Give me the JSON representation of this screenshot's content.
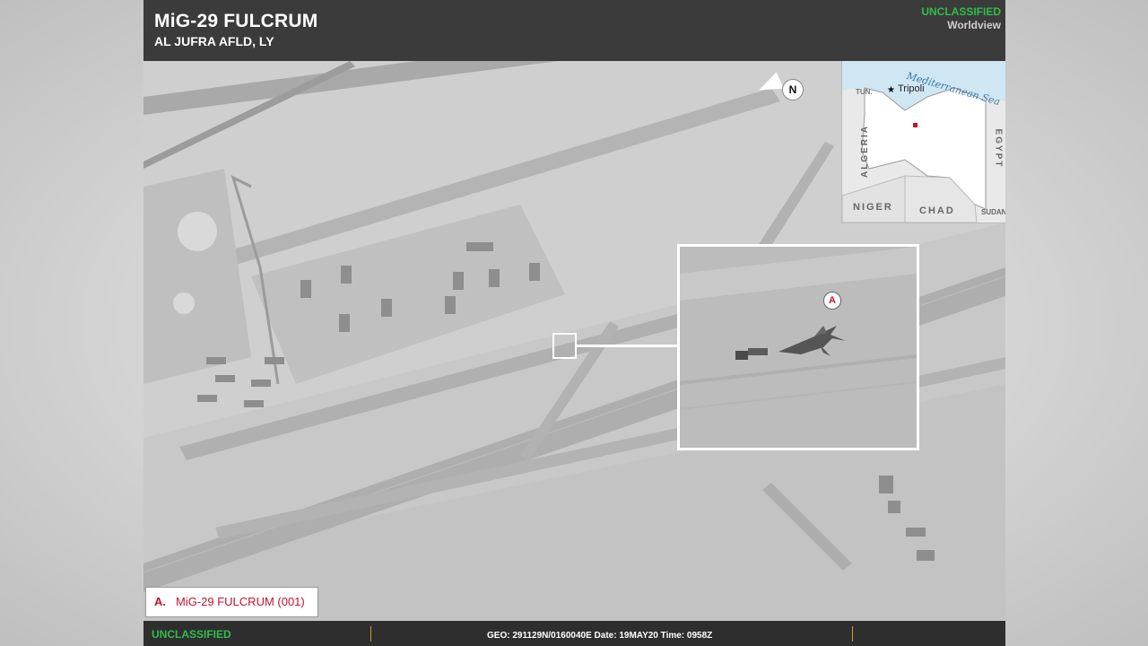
{
  "header": {
    "title": "MiG-29 FULCRUM",
    "subtitle": "AL JUFRA AFLD, LY",
    "classification": "UNCLASSIFIED",
    "source": "Worldview"
  },
  "locator_map": {
    "city": "Tripoli",
    "sea": "Mediterranean Sea",
    "countries": [
      "TUN.",
      "ALGERIA",
      "EGYPT",
      "NIGER",
      "CHAD",
      "SUDAN"
    ],
    "highlight_color": "#ffffff",
    "water_color": "#cfe6f3",
    "marker_color": "#c8102e"
  },
  "compass": {
    "label": "N"
  },
  "inset": {
    "marker_label": "A"
  },
  "legend": {
    "letter": "A.",
    "text": "MiG-29 FULCRUM (001)"
  },
  "footer": {
    "classification": "UNCLASSIFIED",
    "meta": "GEO: 291129N/0160040E Date: 19MAY20  Time: 0958Z"
  },
  "colors": {
    "classification_green": "#2fbe4a",
    "annotation_red": "#c8102e",
    "header_bg": "#3b3b3b"
  }
}
